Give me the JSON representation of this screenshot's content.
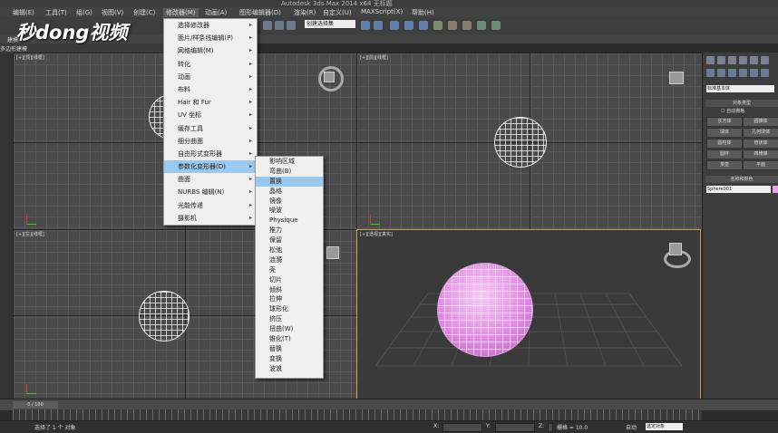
{
  "window": {
    "title": "Autodesk 3ds Max  2014 x64    无标题"
  },
  "menubar": {
    "items": [
      "编辑(E)",
      "工具(T)",
      "组(G)",
      "视图(V)",
      "创建(C)",
      "修改器(M)",
      "动画(A)",
      "图形编辑器(D)",
      "渲染(R)",
      "自定义(U)",
      "MAXScript(X)",
      "帮助(H)"
    ],
    "active": "修改器(M)"
  },
  "toolbar": {
    "selection_set": "创建选择集"
  },
  "ribbon": {
    "tab1": "建模",
    "tab2": "多边形建模"
  },
  "watermark": {
    "text": "秒dong视频"
  },
  "modifier_menu": {
    "items": [
      {
        "label": "选择修改器",
        "arrow": "▸"
      },
      {
        "label": "面片/样条线编辑(P)",
        "arrow": "▸"
      },
      {
        "label": "网格编辑(M)",
        "arrow": "▸"
      },
      {
        "label": "转化",
        "arrow": "▸"
      },
      {
        "label": "动画",
        "arrow": "▸"
      },
      {
        "label": "布料",
        "arrow": "▸"
      },
      {
        "label": "Hair 和 Fur",
        "arrow": "▸"
      },
      {
        "label": "UV 坐标",
        "arrow": "▸"
      },
      {
        "label": "缓存工具",
        "arrow": "▸"
      },
      {
        "label": "细分曲面",
        "arrow": "▸"
      },
      {
        "label": "自由形式变形器",
        "arrow": "▸"
      },
      {
        "label": "参数化变形器(D)",
        "arrow": "▸"
      },
      {
        "label": "曲面",
        "arrow": "▸"
      },
      {
        "label": "NURBS 编辑(N)",
        "arrow": "▸"
      },
      {
        "label": "光能传递",
        "arrow": "▸"
      },
      {
        "label": "摄影机",
        "arrow": "▸"
      }
    ],
    "highlighted_index": 11
  },
  "param_submenu": {
    "items": [
      "影响区域",
      "弯曲(B)",
      "置换",
      "晶格",
      "镜像",
      "噪波",
      "Physique",
      "推力",
      "保留",
      "松弛",
      "涟漪",
      "壳",
      "切片",
      "倾斜",
      "拉伸",
      "球形化",
      "挤压",
      "扭曲(W)",
      "锥化(T)",
      "替换",
      "变换",
      "波浪"
    ],
    "highlighted_index": 2
  },
  "viewports": {
    "top": "[+][顶][线框]",
    "front": "[+][前][线框]",
    "left": "[+][左][线框]",
    "perspective": "[+][透视][真实]"
  },
  "command_panel": {
    "dropdown": "标准基本体",
    "section_object_type": "对象类型",
    "autogrid": "自动栅格",
    "buttons": [
      "长方体",
      "圆锥体",
      "球体",
      "几何球体",
      "圆柱体",
      "管状体",
      "圆环",
      "四棱锥",
      "茶壶",
      "平面"
    ],
    "section_name_color": "名称和颜色",
    "object_name": "Sphere001",
    "object_color": "#e79fe8"
  },
  "timeline": {
    "frame": "0 / 100"
  },
  "status": {
    "selection": "选择了 1 个 对象",
    "x_label": "X:",
    "y_label": "Y:",
    "z_label": "Z:",
    "grid": "栅格 = 10.0",
    "auto": "自动",
    "key_filter": "选定对象"
  }
}
